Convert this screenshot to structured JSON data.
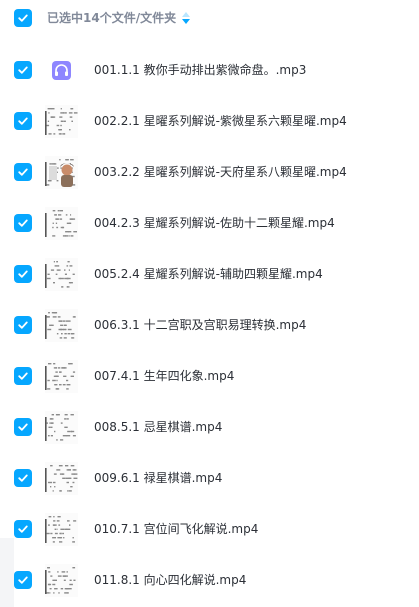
{
  "header": {
    "selection_text": "已选中14个文件/文件夹",
    "sort_icon": "sort-arrows-icon"
  },
  "colors": {
    "accent": "#06a7ff",
    "audio_icon_bg": "#8e86ff",
    "text_primary": "#2b2f36",
    "text_secondary": "#818999"
  },
  "files": [
    {
      "name": "001.1.1 教你手动排出紫微命盘。.mp3",
      "type": "audio",
      "icon": "headphones-icon",
      "checked": true
    },
    {
      "name": "002.2.1 星曜系列解说-紫微星系六颗星曜.mp4",
      "type": "video",
      "icon": "video-thumbnail",
      "checked": true
    },
    {
      "name": "003.2.2 星曜系列解说-天府星系八颗星曜.mp4",
      "type": "video",
      "icon": "video-thumbnail",
      "checked": true
    },
    {
      "name": "004.2.3 星耀系列解说-佐助十二颗星耀.mp4",
      "type": "video",
      "icon": "video-thumbnail",
      "checked": true
    },
    {
      "name": "005.2.4 星耀系列解说-辅助四颗星耀.mp4",
      "type": "video",
      "icon": "video-thumbnail",
      "checked": true
    },
    {
      "name": "006.3.1 十二宫职及宫职易理转换.mp4",
      "type": "video",
      "icon": "video-thumbnail",
      "checked": true
    },
    {
      "name": "007.4.1 生年四化象.mp4",
      "type": "video",
      "icon": "video-thumbnail",
      "checked": true
    },
    {
      "name": "008.5.1 忌星棋谱.mp4",
      "type": "video",
      "icon": "video-thumbnail",
      "checked": true
    },
    {
      "name": "009.6.1 禄星棋谱.mp4",
      "type": "video",
      "icon": "video-thumbnail",
      "checked": true
    },
    {
      "name": "010.7.1 宫位间飞化解说.mp4",
      "type": "video",
      "icon": "video-thumbnail",
      "checked": true
    },
    {
      "name": "011.8.1 向心四化解说.mp4",
      "type": "video",
      "icon": "video-thumbnail",
      "checked": true
    }
  ]
}
